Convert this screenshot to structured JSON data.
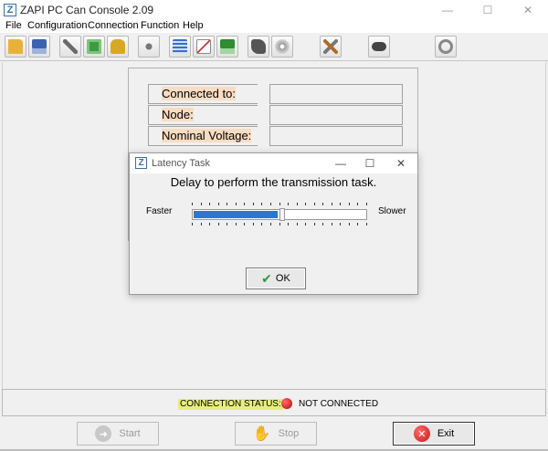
{
  "window": {
    "title": "ZAPI PC Can Console 2.09",
    "icon": "zapi-logo-icon",
    "logo_letter": "Z"
  },
  "menu": [
    "File",
    "Configuration",
    "Connection",
    "Function",
    "Help"
  ],
  "toolbar": {
    "icons": [
      {
        "name": "open-folder-icon",
        "color": "#e8b23a"
      },
      {
        "name": "save-disk-icon",
        "color": "#3a62b0"
      },
      {
        "name": "wrench-tools-icon",
        "color": "#6b6b6b"
      },
      {
        "name": "circuit-board-icon",
        "color": "#3f9a3f"
      },
      {
        "name": "padlock-icon",
        "color": "#d8a825"
      },
      {
        "name": "network-nodes-icon",
        "color": "#777777"
      },
      {
        "name": "monitor-list-icon",
        "color": "#3a6ec8"
      },
      {
        "name": "line-chart-icon",
        "color": "#c83a3a"
      },
      {
        "name": "green-disk-icon",
        "color": "#2f8c2f"
      },
      {
        "name": "can-cable-icon",
        "color": "#555555"
      },
      {
        "name": "cd-disc-icon",
        "color": "#9a9a9a"
      },
      {
        "name": "crossed-tools-icon",
        "color": "#b06a2a"
      },
      {
        "name": "gamepad-icon",
        "color": "#444444"
      },
      {
        "name": "refresh-cycle-icon",
        "color": "#888888"
      }
    ]
  },
  "info_panel": {
    "rows": [
      {
        "label": "Connected to:",
        "value": ""
      },
      {
        "label": "Node:",
        "value": ""
      },
      {
        "label": "Nominal Voltage:",
        "value": ""
      }
    ]
  },
  "dialog": {
    "title": "Latency Task",
    "message": "Delay to perform the transmission task.",
    "faster_label": "Faster",
    "slower_label": "Slower",
    "slider_position": 0.5,
    "ok_label": "OK",
    "fill_color": "#2979d0"
  },
  "status": {
    "label": "CONNECTION STATUS:",
    "value": "NOT CONNECTED",
    "indicator_color": "#c00000"
  },
  "buttons": {
    "start": "Start",
    "stop": "Stop",
    "exit": "Exit"
  }
}
